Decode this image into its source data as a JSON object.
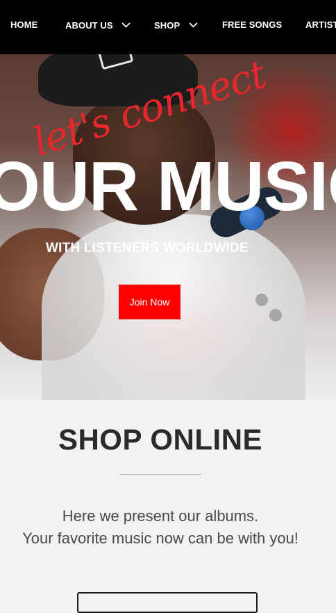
{
  "nav": {
    "items": [
      {
        "label": "HOME"
      },
      {
        "label": "ABOUT US"
      },
      {
        "label": "SHOP"
      },
      {
        "label": "FREE SONGS"
      },
      {
        "label": "ARTIST"
      }
    ]
  },
  "hero": {
    "script_text": "let's connect",
    "headline": "OUR MUSIC",
    "subheadline": "WITH LISTENERS WORLDWIDE",
    "cta_label": "Join Now"
  },
  "shop": {
    "title": "SHOP ONLINE",
    "description_lines": [
      "Here we present our albums.",
      "Your favorite music now can be with you!"
    ]
  },
  "colors": {
    "nav_bg": "#000000",
    "accent_red": "#ff0000",
    "script_red": "#e8262d",
    "section_bg": "#f2f2f2"
  }
}
